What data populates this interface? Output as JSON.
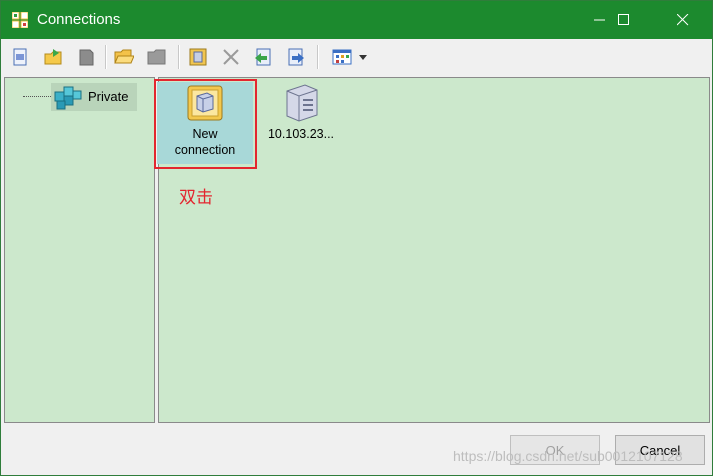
{
  "window": {
    "title": "Connections",
    "title_bar_color": "#1c8a2e"
  },
  "toolbar": {
    "buttons": [
      {
        "name": "new-icon"
      },
      {
        "name": "open-connection-icon"
      },
      {
        "name": "delete-page-icon"
      },
      {
        "name": "open-folder-icon"
      },
      {
        "name": "disabled-folder-icon"
      },
      {
        "name": "properties-icon"
      },
      {
        "name": "delete-x-icon"
      },
      {
        "name": "import-icon"
      },
      {
        "name": "export-icon"
      },
      {
        "name": "view-mode-icon"
      }
    ]
  },
  "tree": {
    "items": [
      {
        "label": "Private",
        "icon": "registry-folder-icon"
      }
    ]
  },
  "connections": [
    {
      "label_line1": "New",
      "label_line2": "connection",
      "icon": "new-connection-icon",
      "selected": true
    },
    {
      "label_line1": "10.103.23...",
      "label_line2": "",
      "icon": "server-icon",
      "selected": false
    }
  ],
  "annotation": {
    "text": "双击",
    "color": "#e3262f"
  },
  "buttons": {
    "ok": "OK",
    "cancel": "Cancel"
  },
  "watermark": "https://blog.csdn.net/sub0012107128"
}
